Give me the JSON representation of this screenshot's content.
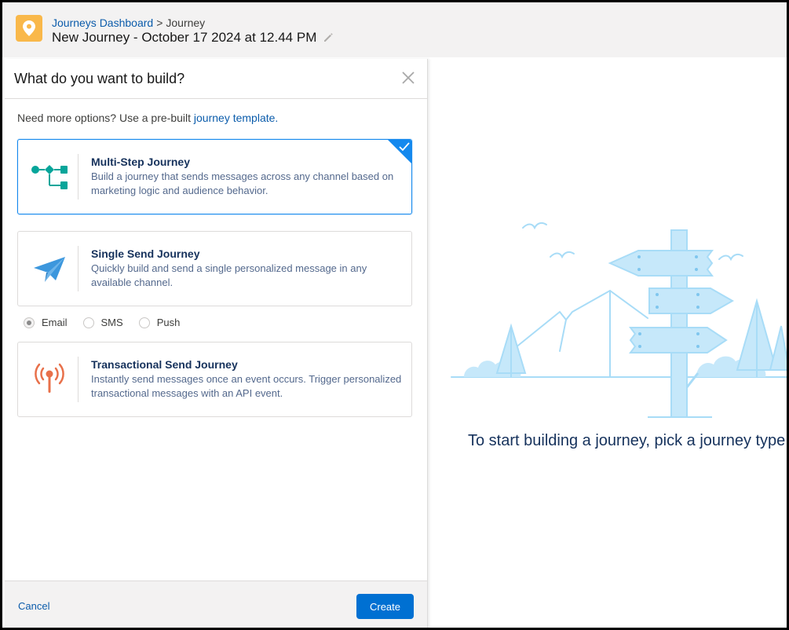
{
  "header": {
    "breadcrumb_link": "Journeys Dashboard",
    "breadcrumb_sep": ">",
    "breadcrumb_current": "Journey",
    "title": "New Journey - October 17 2024 at 12.44 PM",
    "app_icon": "location-pin-icon",
    "edit_icon": "pencil-icon"
  },
  "dialog": {
    "title": "What do you want to build?",
    "hint_prefix": "Need more options? Use a pre-built ",
    "hint_link": "journey template.",
    "cards": [
      {
        "title": "Multi-Step Journey",
        "description": "Build a journey that sends messages across any channel based on marketing logic and audience behavior.",
        "icon": "flow-icon",
        "selected": true
      },
      {
        "title": "Single Send Journey",
        "description": "Quickly build and send a single personalized message in any available channel.",
        "icon": "paper-plane-icon",
        "selected": false
      },
      {
        "title": "Transactional Send Journey",
        "description": "Instantly send messages once an event occurs. Trigger personalized transactional messages with an API event.",
        "icon": "broadcast-icon",
        "selected": false
      }
    ],
    "channels": [
      {
        "label": "Email",
        "selected": true
      },
      {
        "label": "SMS",
        "selected": false
      },
      {
        "label": "Push",
        "selected": false
      }
    ],
    "cancel_label": "Cancel",
    "create_label": "Create"
  },
  "empty_state": {
    "message": "To start building a journey, pick a journey type."
  },
  "colors": {
    "accent": "#0070d2",
    "selected_border": "#1589ee",
    "app_icon_bg": "#f9b84a",
    "flow_icon": "#06a59a",
    "plane_icon": "#3c97dd",
    "broadcast_icon": "#e8704a",
    "illustration": "#a8dcf7"
  }
}
